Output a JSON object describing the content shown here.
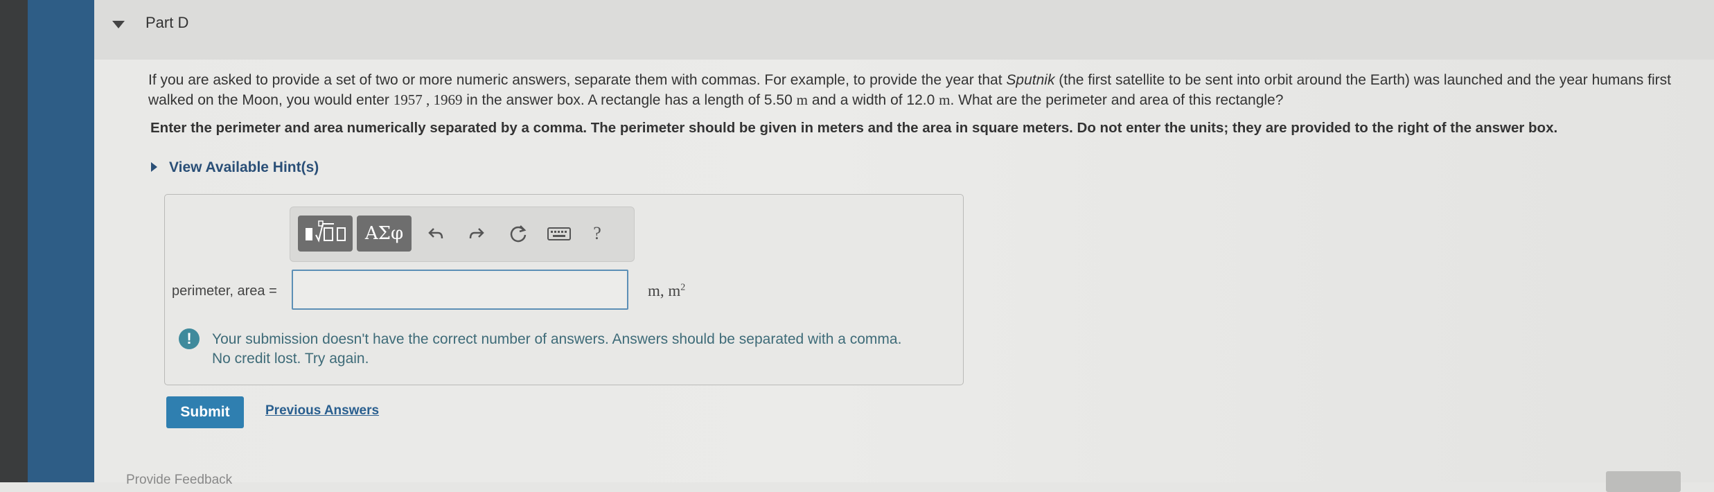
{
  "part": {
    "title": "Part D"
  },
  "question": {
    "p1": "If you are asked to provide a set of two or more numeric answers, separate them with commas. For example, to provide the year that ",
    "p1_italic": "Sputnik",
    "p2": " (the first satellite to be sent into orbit around the Earth) was launched and the year humans first walked on the Moon, you would enter ",
    "example": "1957 , 1969",
    "p3": " in the answer box. A rectangle has a length of 5.50 ",
    "unit_m1": "m",
    "p4": " and a width of 12.0 ",
    "unit_m2": "m",
    "p5": ". What are the perimeter and area of this rectangle?",
    "instruction": "Enter the perimeter and area numerically separated by a comma. The perimeter should be given in meters and the area in square meters. Do not enter the units; they are provided to the right of the answer box."
  },
  "hints": {
    "label": "View Available Hint(s)"
  },
  "toolbar": {
    "symbols_label": "ΑΣφ",
    "help_label": "?"
  },
  "answer": {
    "label": "perimeter, area =",
    "value": "",
    "units_main": "m, m",
    "units_sup": "2"
  },
  "feedback": {
    "icon_text": "!",
    "line1": "Your submission doesn't have the correct number of answers. Answers should be separated with a comma.",
    "line2": "No credit lost. Try again."
  },
  "actions": {
    "submit_label": "Submit",
    "previous_answers_label": "Previous Answers"
  },
  "footer": {
    "provide_feedback": "Provide Feedback"
  },
  "colors": {
    "accent": "#2f7fb0",
    "sidebar": "#2e5d86",
    "feedback": "#3f8a9c"
  }
}
